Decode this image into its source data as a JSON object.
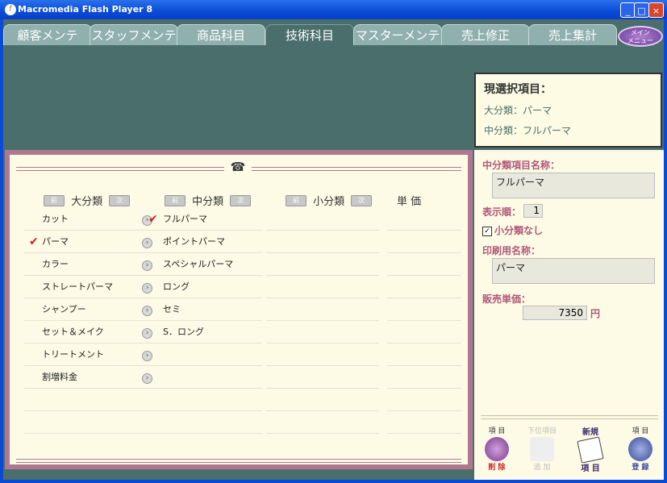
{
  "window": {
    "title": "Macromedia Flash Player 8",
    "buttons": [
      "_",
      "□",
      "×"
    ]
  },
  "tabs": [
    {
      "label": "顧客メンテ"
    },
    {
      "label": "スタッフメンテ"
    },
    {
      "label": "商品科目"
    },
    {
      "label": "技術科目"
    },
    {
      "label": "マスターメンテ"
    },
    {
      "label": "売上修正"
    },
    {
      "label": "売上集計"
    }
  ],
  "menu_button": {
    "line1": "メイン",
    "line2": "メニュー"
  },
  "selection": {
    "heading": "現選択項目：",
    "large": "大分類：パーマ",
    "middle": "中分類：フルパーマ"
  },
  "columns": {
    "large": {
      "label": "大分類",
      "prev": "前",
      "next": "次"
    },
    "middle": {
      "label": "中分類",
      "prev": "前",
      "next": "次"
    },
    "small": {
      "label": "小分類",
      "prev": "前",
      "next": "次"
    },
    "price": {
      "label": "単 価"
    }
  },
  "large_items": [
    "カット",
    "パーマ",
    "カラー",
    "ストレートパーマ",
    "シャンプー",
    "セット＆メイク",
    "トリートメント",
    "割増料金"
  ],
  "middle_items": [
    "フルパーマ",
    "ポイントパーマ",
    "スペシャルパーマ",
    "ロング",
    "セミ",
    "S．ロング"
  ],
  "selected": {
    "large_index": 1,
    "middle_index": 0
  },
  "detail": {
    "middle_name_label": "中分類項目名称：",
    "middle_name_value": "フルパーマ",
    "order_label": "表示順：",
    "order_value": "1",
    "no_small_label": "小分類なし",
    "no_small_checked": true,
    "print_name_label": "印刷用名称：",
    "print_name_value": "パーマ",
    "price_label": "販売単価：",
    "price_value": "7350",
    "price_unit": "円"
  },
  "actions": {
    "delete": {
      "top": "項 目",
      "bottom": "削 除"
    },
    "lower": {
      "top": "下位項目",
      "bottom": "追 加"
    },
    "new": {
      "top": "新規",
      "bottom": "項 目"
    },
    "save": {
      "top": "項 目",
      "bottom": "登 録"
    }
  },
  "colors": {
    "accent": "#b05878",
    "panel": "#fdfbe6",
    "background": "#4a6e6c"
  }
}
